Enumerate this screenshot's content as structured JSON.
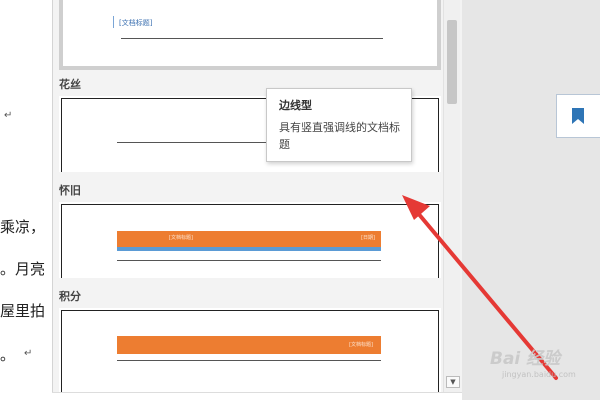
{
  "document": {
    "lines": [
      {
        "text": "乘凉，",
        "trailing_fragment": "a"
      },
      {
        "text": "。月亮"
      },
      {
        "text": "屋里拍"
      },
      {
        "text": "。"
      }
    ],
    "paragraph_mark": "↵"
  },
  "gallery": {
    "top_item_placeholder": "[文档标题]",
    "sections": [
      {
        "label": "花丝"
      },
      {
        "label": "怀旧",
        "placeholder_left": "[文档标题]",
        "placeholder_right": "[日期]"
      },
      {
        "label": "积分",
        "placeholder_right": "[文档标题]"
      }
    ]
  },
  "tooltip": {
    "title": "边线型",
    "description": "具有竖直强调线的文档标题"
  },
  "watermark": {
    "text": "Bai 经验",
    "url": "jingyan.baidu.com"
  },
  "colors": {
    "accent_orange": "#ed7d31",
    "accent_blue": "#5b9bd5",
    "arrow_red": "#e53935",
    "bookmark_blue": "#2e75b6"
  },
  "icons": {
    "bookmark": "bookmark-icon",
    "scroll_down": "scroll-down-arrow-icon"
  }
}
